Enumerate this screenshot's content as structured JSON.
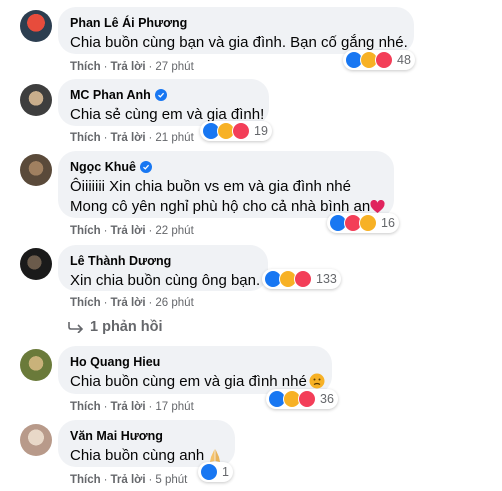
{
  "comments": [
    {
      "author": "Phan Lê Ái Phương",
      "verified": false,
      "lines": [
        "Chia buồn cùng bạn và gia đình. Bạn cố gắng nhé."
      ],
      "like": "Thích",
      "reply": "Trả lời",
      "time": "27 phút",
      "reaction_count": "48",
      "reactions": [
        "like",
        "sad",
        "love"
      ],
      "avatar_colors": [
        "#c0392b",
        "#2c3e50"
      ]
    },
    {
      "author": "MC Phan Anh",
      "verified": true,
      "lines": [
        "Chia sẻ cùng em và gia đình!"
      ],
      "like": "Thích",
      "reply": "Trả lời",
      "time": "21 phút",
      "reaction_count": "19",
      "reactions": [
        "like",
        "sad",
        "love"
      ],
      "avatar_colors": [
        "#3e3e3e",
        "#b8a58a"
      ]
    },
    {
      "author": "Ngọc Khuê",
      "verified": true,
      "lines": [
        "Ôiiiiiii Xin chia buồn vs em và gia đình nhé",
        "Mong cô yên nghỉ phù hộ cho cả nhà bình an"
      ],
      "trailing_emoji": "heart",
      "like": "Thích",
      "reply": "Trả lời",
      "time": "22 phút",
      "reaction_count": "16",
      "reactions": [
        "like",
        "love",
        "sad"
      ],
      "avatar_colors": [
        "#5a4a3a",
        "#a08060"
      ]
    },
    {
      "author": "Lê Thành Dương",
      "verified": false,
      "lines": [
        "Xin chia buồn cùng ông bạn."
      ],
      "like": "Thích",
      "reply": "Trả lời",
      "time": "26 phút",
      "reaction_count": "133",
      "reactions": [
        "like",
        "sad",
        "love"
      ],
      "avatar_colors": [
        "#1a1a1a",
        "#6b5b4b"
      ]
    },
    {
      "author": "Ho Quang Hieu",
      "verified": false,
      "lines": [
        "Chia buồn cùng em và gia đình nhé"
      ],
      "trailing_emoji": "sad",
      "like": "Thích",
      "reply": "Trả lời",
      "time": "17 phút",
      "reaction_count": "36",
      "reactions": [
        "like",
        "sad",
        "love"
      ],
      "avatar_colors": [
        "#6a7a3a",
        "#c9b27a"
      ]
    },
    {
      "author": "Văn Mai Hương",
      "verified": false,
      "lines": [
        "Chia buồn cùng anh"
      ],
      "trailing_emoji": "pray",
      "like": "Thích",
      "reply": "Trả lời",
      "time": "5 phút",
      "reaction_count": "1",
      "reactions": [
        "like"
      ],
      "avatar_colors": [
        "#d9c7b8",
        "#8a6a5a"
      ]
    }
  ],
  "replies_link": {
    "label": "1 phản hồi"
  },
  "colors": {
    "like": "#1877f2",
    "sad": "#f7b125",
    "love": "#f33e58",
    "bubble": "#f0f2f5",
    "meta": "#65676b"
  }
}
